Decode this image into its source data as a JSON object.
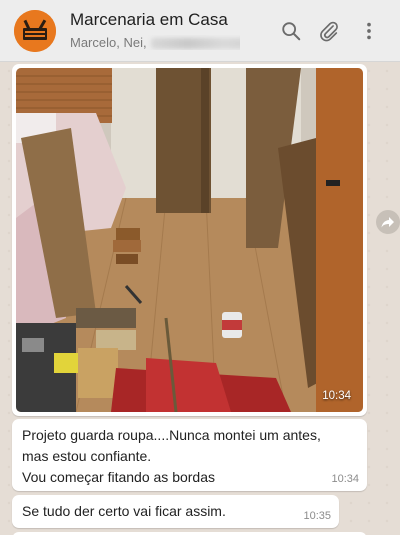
{
  "header": {
    "title": "Marcenaria em Casa",
    "subtitle": "Marcelo, Nei,",
    "icons": [
      "search-icon",
      "paperclip-icon",
      "more-vertical-icon"
    ]
  },
  "messages": [
    {
      "type": "image",
      "time": "10:34",
      "image_description_icon": "photo"
    },
    {
      "type": "text",
      "lines": [
        "Projeto guarda roupa....Nunca montei um antes,",
        "mas estou confiante.",
        "Vou começar fitando as bordas"
      ],
      "time": "10:34"
    },
    {
      "type": "text",
      "lines": [
        "Se tudo der certo vai ficar assim."
      ],
      "time": "10:35"
    }
  ],
  "colors": {
    "header_bg": "#ededed",
    "chat_bg": "#e5ddd5",
    "bubble_bg": "#ffffff",
    "avatar_bg": "#e8781e"
  }
}
